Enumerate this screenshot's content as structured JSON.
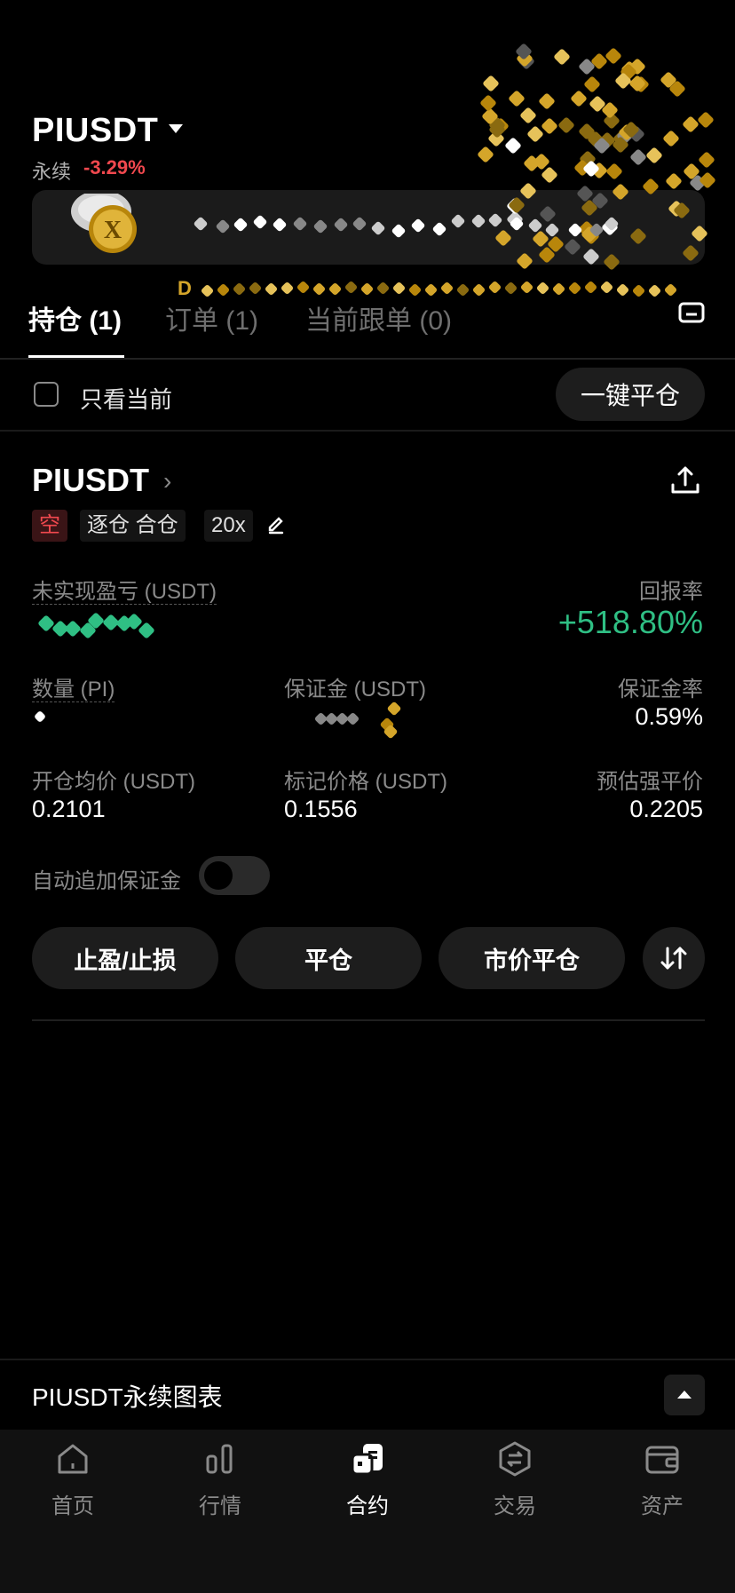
{
  "header": {
    "symbol": "PIUSDT",
    "perp_label": "永续",
    "change": "-3.29%"
  },
  "banner": {
    "text": "D"
  },
  "tabs": [
    {
      "label": "持仓 (1)",
      "active": true
    },
    {
      "label": "订单 (1)",
      "active": false
    },
    {
      "label": "当前跟单 (0)",
      "active": false
    }
  ],
  "filter": {
    "label": "只看当前",
    "close_all": "一键平仓"
  },
  "position": {
    "symbol": "PIUSDT",
    "side": "空",
    "margin_mode": "逐仓 合仓",
    "leverage": "20x",
    "upl_label": "未实现盈亏 (USDT)",
    "roe_label": "回报率",
    "roe_value": "+518.80%",
    "qty_label": "数量 (PI)",
    "margin_label": "保证金 (USDT)",
    "margin_rate_label": "保证金率",
    "margin_rate_value": "0.59%",
    "entry_label": "开仓均价 (USDT)",
    "entry_value": "0.2101",
    "mark_label": "标记价格 (USDT)",
    "mark_value": "0.1556",
    "liq_label": "预估强平价",
    "liq_value": "0.2205",
    "auto_margin_label": "自动追加保证金",
    "auto_margin_on": false
  },
  "actions": {
    "tpsl": "止盈/止损",
    "close": "平仓",
    "market_close": "市价平仓"
  },
  "chart_bar": {
    "label": "PIUSDT永续图表"
  },
  "nav": [
    {
      "label": "首页",
      "icon": "home-icon"
    },
    {
      "label": "行情",
      "icon": "markets-icon"
    },
    {
      "label": "合约",
      "icon": "futures-icon",
      "active": true
    },
    {
      "label": "交易",
      "icon": "trade-icon"
    },
    {
      "label": "资产",
      "icon": "wallet-icon"
    }
  ],
  "colors": {
    "red": "#f0484e",
    "green": "#2fbf84",
    "gold": "#d4a52a"
  }
}
